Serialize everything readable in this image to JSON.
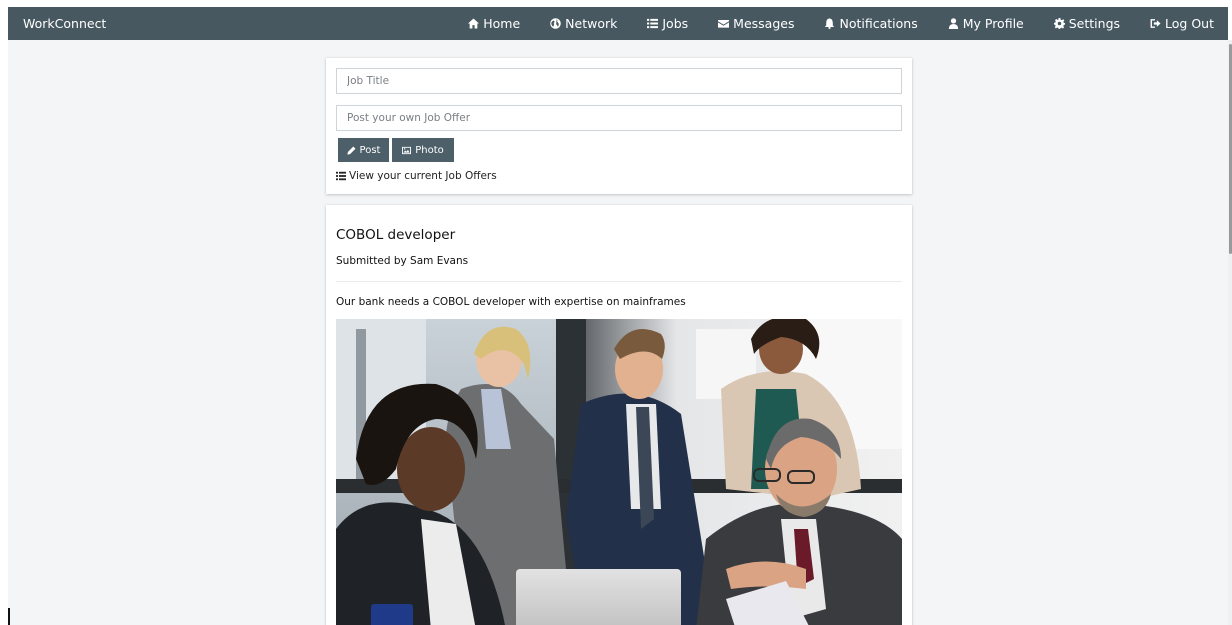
{
  "app": {
    "brand": "WorkConnect"
  },
  "nav": {
    "items": [
      {
        "label": "Home",
        "icon": "home-icon"
      },
      {
        "label": "Network",
        "icon": "globe-icon"
      },
      {
        "label": "Jobs",
        "icon": "list-icon"
      },
      {
        "label": "Messages",
        "icon": "envelope-icon"
      },
      {
        "label": "Notifications",
        "icon": "bell-icon"
      },
      {
        "label": "My Profile",
        "icon": "user-icon"
      },
      {
        "label": "Settings",
        "icon": "gear-icon"
      },
      {
        "label": "Log Out",
        "icon": "logout-icon"
      }
    ]
  },
  "post_form": {
    "title_placeholder": "Job Title",
    "offer_placeholder": "Post your own Job Offer",
    "post_label": "Post",
    "photo_label": "Photo",
    "view_offers_label": "View your current Job Offers"
  },
  "job": {
    "title": "COBOL developer",
    "submitted_by": "Submitted by Sam Evans",
    "description": "Our bank needs a COBOL developer with expertise on mainframes",
    "image_subject": "business-team-meeting-photo"
  },
  "colors": {
    "navbar": "#475861",
    "button": "#4d5f69",
    "page_background": "#f4f5f7"
  }
}
